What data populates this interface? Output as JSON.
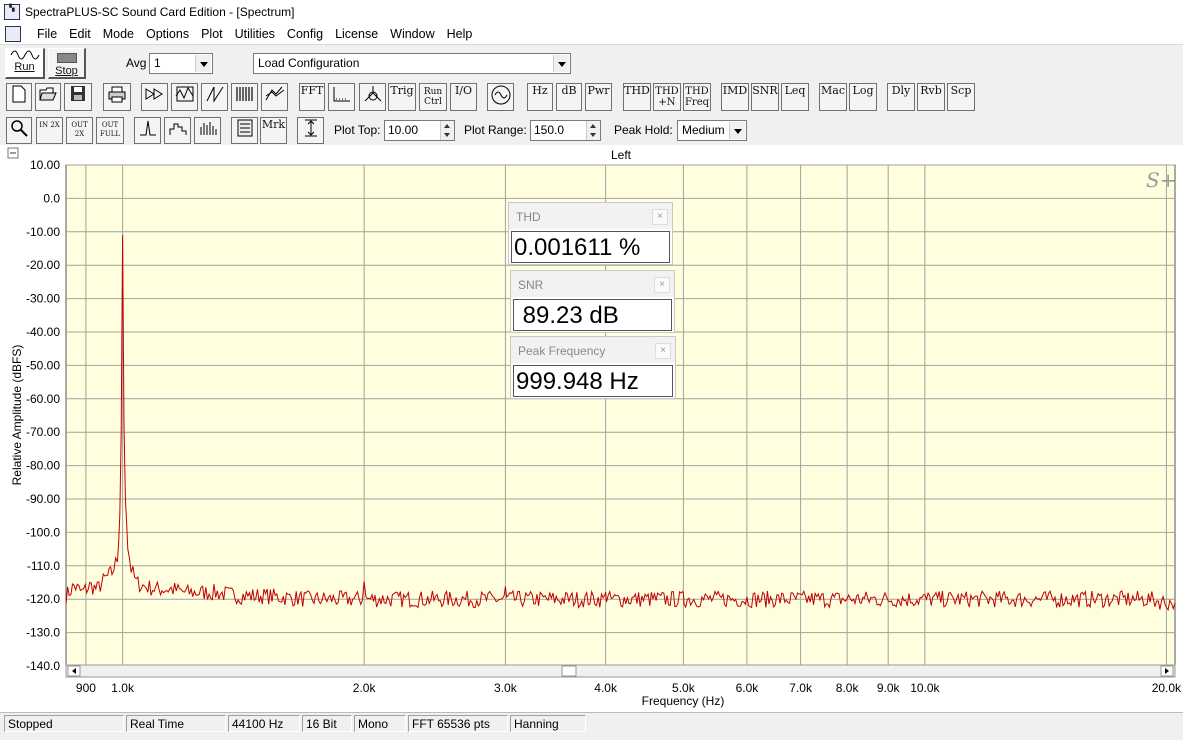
{
  "window": {
    "title": "SpectraPLUS-SC Sound Card Edition - [Spectrum]"
  },
  "menu": [
    "File",
    "Edit",
    "Mode",
    "Options",
    "Plot",
    "Utilities",
    "Config",
    "License",
    "Window",
    "Help"
  ],
  "toolbar1": {
    "run_label": "Run",
    "stop_label": "Stop",
    "avg_label": "Avg",
    "avg_value": "1",
    "config_value": "Load Configuration"
  },
  "toolbar2": {
    "buttons": [
      "FFT",
      "Trig",
      "Run Ctrl",
      "I/O",
      "Hz",
      "dB",
      "Pwr",
      "THD",
      "THD +N",
      "THD Freq",
      "IMD",
      "SNR",
      "Leq",
      "Mac",
      "Log",
      "Dly",
      "Rvb",
      "Scp"
    ],
    "icons": [
      "new-file-icon",
      "open-folder-icon",
      "save-icon",
      "print-icon",
      "fast-forward-icon",
      "edit-signal-icon",
      "ramp-icon",
      "spectrogram-icon",
      "3d-plot-icon",
      "phase-icon",
      "time-series-icon",
      "oscillator-icon"
    ]
  },
  "toolbar3": {
    "zoom_in_2x": "IN 2X",
    "zoom_out_2x": "OUT 2X",
    "zoom_out_full": "OUT FULL",
    "mrk_label": "Mrk",
    "plot_top_label": "Plot Top:",
    "plot_top_value": "10.00",
    "plot_range_label": "Plot Range:",
    "plot_range_value": "150.0",
    "peak_hold_label": "Peak Hold:",
    "peak_hold_value": "Medium"
  },
  "plot": {
    "channel": "Left",
    "logo": "S+",
    "colors": {
      "background": "#ffffe0",
      "grid": "#a0a0a0",
      "trace": "#c00000"
    }
  },
  "meters": [
    {
      "title": "THD",
      "value": "0.001611 %"
    },
    {
      "title": "SNR",
      "value": " 89.23 dB"
    },
    {
      "title": "Peak Frequency",
      "value": "999.948 Hz"
    }
  ],
  "chart_data": {
    "type": "line",
    "title": "",
    "xlabel": "Frequency (Hz)",
    "ylabel": "Relative Amplitude (dBFS)",
    "x_scale": "log",
    "xlim": [
      850,
      20500
    ],
    "ylim": [
      -140,
      10
    ],
    "x_ticks": [
      {
        "value": 900,
        "label": "900"
      },
      {
        "value": 1000,
        "label": "1.0k"
      },
      {
        "value": 2000,
        "label": "2.0k"
      },
      {
        "value": 3000,
        "label": "3.0k"
      },
      {
        "value": 4000,
        "label": "4.0k"
      },
      {
        "value": 5000,
        "label": "5.0k"
      },
      {
        "value": 6000,
        "label": "6.0k"
      },
      {
        "value": 7000,
        "label": "7.0k"
      },
      {
        "value": 8000,
        "label": "8.0k"
      },
      {
        "value": 9000,
        "label": "9.0k"
      },
      {
        "value": 10000,
        "label": "10.0k"
      },
      {
        "value": 20000,
        "label": "20.0k"
      }
    ],
    "y_ticks": [
      "10.00",
      "0.0",
      "-10.00",
      "-20.00",
      "-30.00",
      "-40.00",
      "-50.00",
      "-60.00",
      "-70.00",
      "-80.00",
      "-90.00",
      "-100.0",
      "-110.0",
      "-120.0",
      "-130.0",
      "-140.0"
    ],
    "grid": true,
    "series": [
      {
        "x": [
          850,
          870,
          890,
          910,
          930,
          950,
          970,
          985,
          992,
          996,
          998,
          999.948,
          1002,
          1004,
          1008,
          1015,
          1025,
          1040,
          1060,
          1100,
          1150,
          1200,
          1300,
          1400,
          1500,
          1700,
          1900,
          1990,
          2000,
          2010,
          2100,
          2400,
          2700,
          2990,
          3000,
          3010,
          3300,
          3700,
          3990,
          4000,
          4010,
          4500,
          4990,
          5000,
          5010,
          5500,
          6000,
          7000,
          8000,
          9000,
          10000,
          12000,
          14000,
          16000,
          18000,
          19000,
          20000,
          20500
        ],
        "y": [
          -119,
          -116,
          -118,
          -116,
          -117,
          -114,
          -112,
          -108,
          -95,
          -70,
          -40,
          -11,
          -40,
          -68,
          -90,
          -104,
          -111,
          -115,
          -116,
          -117,
          -117,
          -118,
          -118,
          -119,
          -119,
          -120,
          -120,
          -120,
          -113,
          -120,
          -120,
          -120,
          -120,
          -120,
          -117,
          -120,
          -120,
          -120,
          -120,
          -116,
          -120,
          -120,
          -120,
          -117,
          -120,
          -120,
          -120,
          -120,
          -120,
          -120,
          -120,
          -120,
          -120,
          -120,
          -120,
          -120,
          -121,
          -121
        ]
      }
    ]
  },
  "status": [
    "Stopped",
    "Real Time",
    "44100 Hz",
    "16 Bit",
    "Mono",
    "FFT 65536 pts",
    "Hanning"
  ]
}
